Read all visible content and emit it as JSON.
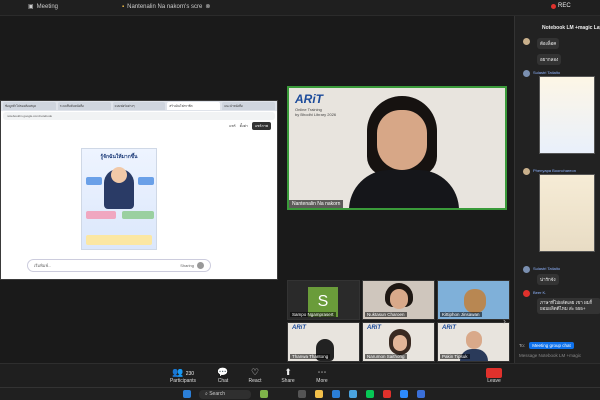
{
  "titlebar": {
    "app_label": "Meeting",
    "share_label": "Nantenalin Na nakorn's scre",
    "rec_label": "REC"
  },
  "shared_screen": {
    "tabs": [
      "ข้อมูลทั่วไปของห้องสมุด",
      "ระบบสืบค้นหนังสือ",
      "แบบฟอร์มต่างๆ",
      "สร้างอินโฟกราฟิก",
      "แนะนำหนังสือ"
    ],
    "address": "notebooklm.google.com/notebook",
    "toolbar": {
      "share": "แชร์",
      "settings": "ตั้งค่า",
      "share_btn": "แชร์ภาพ"
    },
    "poster_title": "รู้จักฉันให้มากขึ้น",
    "prompt_placeholder": "เริ่มพิมพ์...",
    "prompt_right": "Sharing"
  },
  "speaker": {
    "logo": "ARiT",
    "logo_sub_1": "Online Training",
    "logo_sub_2": "by Bhodhi Library 2026",
    "name": "Nantenalin Na nakorn"
  },
  "gallery": [
    {
      "name": "Sampo Ngamprasert",
      "kind": "initial",
      "initial": "S"
    },
    {
      "name": "Nuktasun Charoen",
      "kind": "photo"
    },
    {
      "name": "Kittiphon Jinsawan",
      "kind": "dog"
    },
    {
      "name": "Thanwa Thantong",
      "kind": "logo"
    },
    {
      "name": "Narumon Saithong",
      "kind": "avatar"
    },
    {
      "name": "Pakin Tipsuk",
      "kind": "avatar2"
    }
  ],
  "chat": {
    "title": "Notebook LM +magic Lay",
    "messages": [
      {
        "text": "ต้องล็อค"
      },
      {
        "text": "อยากลอง"
      },
      {
        "who": "Sulastri Tatialto",
        "kind": "image1"
      },
      {
        "who": "Phenyapa Boonchareon",
        "kind": "image2"
      },
      {
        "who": "Sulastri Tatialto",
        "text": "น่ารักจัง"
      },
      {
        "who": "Beer K.",
        "text": "ภาษาที่ไม่ผลัดเลย เขา ผมก็ยอมผลิตดีไหม ส่ะ 555+"
      }
    ],
    "composer_to": "To:",
    "composer_chip": "Meeting group chat",
    "composer_placeholder": "Message Notebook LM +magic"
  },
  "controls": {
    "participants": "Participants",
    "participants_count": "230",
    "chat": "Chat",
    "react": "React",
    "share": "Share",
    "more": "More",
    "leave": "Leave"
  },
  "taskbar": {
    "search": "Search"
  }
}
